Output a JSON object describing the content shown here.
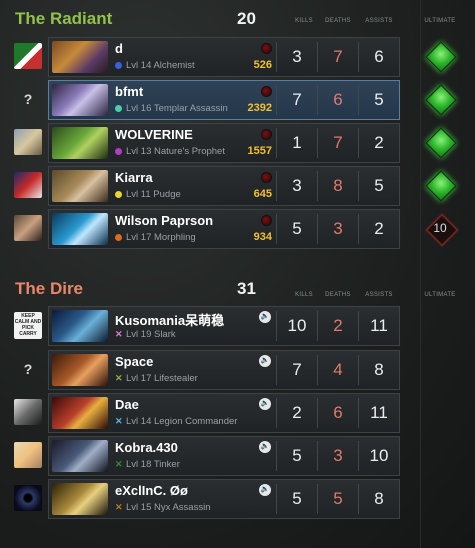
{
  "radiant": {
    "name": "The Radiant",
    "score": "20",
    "headers": {
      "kills": "KILLS",
      "deaths": "DEATHS",
      "assists": "ASSISTS",
      "ultimate": "ULTIMATE"
    },
    "players": [
      {
        "name": "d",
        "info": "Lvl 14 Alchemist",
        "gold": "526",
        "kills": "3",
        "deaths": "7",
        "assists": "6",
        "dot_color": "#3a5fd9",
        "ult": "ready"
      },
      {
        "name": "bfmt",
        "info": "Lvl 16 Templar Assassin",
        "gold": "2392",
        "kills": "7",
        "deaths": "6",
        "assists": "5",
        "dot_color": "#4ccfa8",
        "ult": "ready"
      },
      {
        "name": "WOLVERINE",
        "info": "Lvl 13 Nature's Prophet",
        "gold": "1557",
        "kills": "1",
        "deaths": "7",
        "assists": "2",
        "dot_color": "#b03cc8",
        "ult": "ready"
      },
      {
        "name": "Kiarra",
        "info": "Lvl 11 Pudge",
        "gold": "645",
        "kills": "3",
        "deaths": "8",
        "assists": "5",
        "dot_color": "#e8d534",
        "ult": "ready"
      },
      {
        "name": "Wilson Paprson",
        "info": "Lvl 17 Morphling",
        "gold": "934",
        "kills": "5",
        "deaths": "3",
        "assists": "2",
        "dot_color": "#e06a1c",
        "ult": "cooldown",
        "ult_cd": "10"
      }
    ]
  },
  "dire": {
    "name": "The Dire",
    "score": "31",
    "headers": {
      "kills": "KILLS",
      "deaths": "DEATHS",
      "assists": "ASSISTS",
      "ultimate": "ULTIMATE"
    },
    "players": [
      {
        "name": "Kusomania呆萌稳",
        "info": "Lvl 19 Slark",
        "kills": "10",
        "deaths": "2",
        "assists": "11",
        "x_color": "#e07ad0"
      },
      {
        "name": "Space",
        "info": "Lvl 17 Lifestealer",
        "kills": "7",
        "deaths": "4",
        "assists": "8",
        "x_color": "#8ab04a"
      },
      {
        "name": "Dae",
        "info": "Lvl 14 Legion Commander",
        "kills": "2",
        "deaths": "6",
        "assists": "11",
        "x_color": "#5ab8d8"
      },
      {
        "name": "Kobra.430",
        "info": "Lvl 18 Tinker",
        "kills": "5",
        "deaths": "3",
        "assists": "10",
        "x_color": "#2f8a3a"
      },
      {
        "name": "eXclInC. Øø",
        "info": "Lvl 15 Nyx Assassin",
        "kills": "5",
        "deaths": "5",
        "assists": "8",
        "x_color": "#b07a28"
      }
    ]
  },
  "unknown_avatar_glyph": "?",
  "avatar_caption": "KEEP CALM AND PICK CARRY",
  "colors": {
    "radiant_title": "#92c24a",
    "dire_title": "#e8876a",
    "deaths": "#e07a6e",
    "gold": "#f3c12e",
    "highlight_row": "#2f4256"
  },
  "icons": {
    "ultimate_ready": "green-gem-icon",
    "ultimate_cooldown": "cooldown-diamond-icon",
    "voice": "speaker-icon",
    "indicator": "red-indicator-icon"
  }
}
